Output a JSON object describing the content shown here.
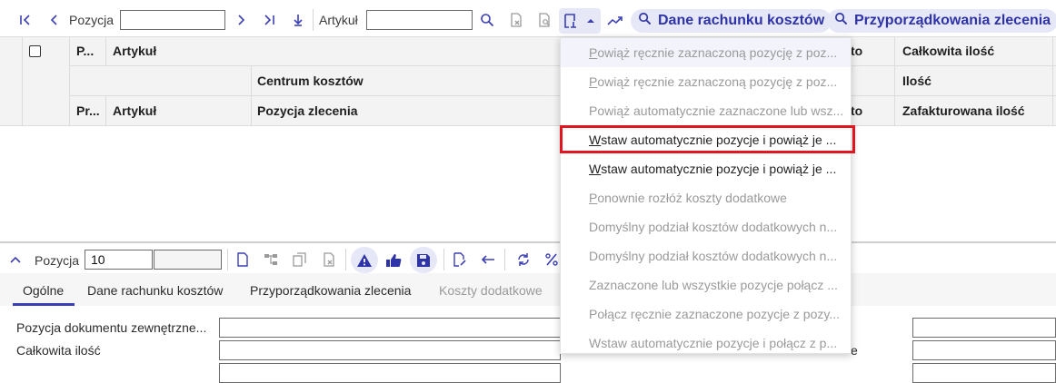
{
  "toolbar": {
    "position_label": "Pozycja",
    "position_value": "",
    "article_label": "Artykuł",
    "article_value": "",
    "dane_button": "Dane rachunku kosztów",
    "przypo_button": "Przyporządkowania zlecenia"
  },
  "grid": {
    "row1": {
      "col_p": "P...",
      "col_artykul": "Artykuł",
      "col_to": "to",
      "col_calkowita": "Całkowita ilość"
    },
    "row2": {
      "col_centrum": "Centrum kosztów",
      "col_ilosc": "Ilość"
    },
    "row3": {
      "col_pr": "Pr...",
      "col_artykul": "Artykuł",
      "col_pozycja": "Pozycja zlecenia",
      "col_to": "to",
      "col_zafakturowana": "Zafakturowana ilość"
    }
  },
  "menu": {
    "items": [
      {
        "underline": "P",
        "rest": "owiąż ręcznie zaznaczoną pozycję z poz...",
        "enabled": false
      },
      {
        "underline": "P",
        "rest": "owiąż ręcznie zaznaczoną pozycję z poz...",
        "enabled": false
      },
      {
        "underline": "",
        "rest": "Powiąż automatycznie zaznaczone lub wsz...",
        "enabled": false
      },
      {
        "underline": "W",
        "rest": "staw automatycznie pozycje i powiąż je ...",
        "enabled": true
      },
      {
        "underline": "W",
        "rest": "staw automatycznie pozycje i powiąż je ...",
        "enabled": true
      },
      {
        "underline": "P",
        "rest": "onownie rozłóż koszty dodatkowe",
        "enabled": false
      },
      {
        "underline": "",
        "rest": "Domyślny podział kosztów dodatkowych n...",
        "enabled": false
      },
      {
        "underline": "",
        "rest": "Domyślny podział kosztów dodatkowych n...",
        "enabled": false
      },
      {
        "underline": "",
        "rest": "Zaznaczone lub wszystkie pozycje połącz ...",
        "enabled": false
      },
      {
        "underline": "",
        "rest": "Połącz ręcznie zaznaczone pozycje z pozy...",
        "enabled": false
      },
      {
        "underline": "",
        "rest": "Wstaw automatycznie pozycje i połącz z p...",
        "enabled": false
      }
    ]
  },
  "detail": {
    "position_label": "Pozycja",
    "position_value": "10",
    "tabs": [
      "Ogólne",
      "Dane rachunku kosztów",
      "Przyporządkowania zlecenia",
      "Koszty dodatkowe"
    ],
    "fields": {
      "pozycja_dok": "Pozycja dokumentu zewnętrzne...",
      "calkowita": "Całkowita ilość",
      "right_partial": "e"
    }
  },
  "colors": {
    "accent": "#3b3fb6",
    "highlight": "#e0151f",
    "pill_bg": "#e6e8f7"
  },
  "icons": [
    "first-page-icon",
    "prev-icon",
    "next-icon",
    "last-page-icon",
    "download-icon",
    "search-icon",
    "clear-filter-icon",
    "filter-search-icon",
    "link-cost-icon",
    "dropdown-arrow-icon",
    "shuffle-icon",
    "collapse-icon",
    "new-doc-icon",
    "hierarchy-icon",
    "copy-icon",
    "delete-doc-icon",
    "warning-icon",
    "thumbs-up-icon",
    "save-icon",
    "edit-doc-icon",
    "undo-icon",
    "distribute-icon",
    "percent-icon"
  ]
}
